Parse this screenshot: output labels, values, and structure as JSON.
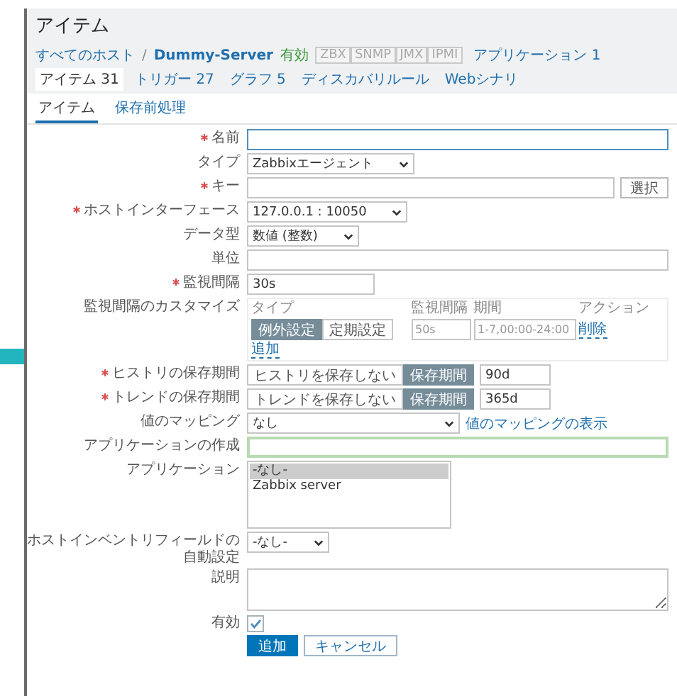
{
  "page_title": "アイテム",
  "host_nav": {
    "all_hosts": "すべてのホスト",
    "separator": "/",
    "host": "Dummy-Server",
    "status": "有効",
    "interfaces": [
      {
        "label": "ZBX",
        "available": false
      },
      {
        "label": "SNMP",
        "available": false
      },
      {
        "label": "JMX",
        "available": false
      },
      {
        "label": "IPMI",
        "available": false
      }
    ],
    "tabs": [
      {
        "label": "アプリケーション 1",
        "selected": false
      },
      {
        "label": "アイテム 31",
        "selected": true
      },
      {
        "label": "トリガー 27",
        "selected": false
      },
      {
        "label": "グラフ 5",
        "selected": false
      },
      {
        "label": "ディスカバリルール",
        "selected": false
      },
      {
        "label": "Webシナリ",
        "selected": false
      }
    ]
  },
  "sub_tabs": [
    {
      "label": "アイテム",
      "selected": true
    },
    {
      "label": "保存前処理",
      "selected": false
    }
  ],
  "form": {
    "rows": [
      {
        "kind": "text",
        "label": "名前",
        "required": true,
        "focused": true
      },
      {
        "kind": "select",
        "label": "タイプ",
        "required": false,
        "value": "Zabbixエージェント"
      },
      {
        "kind": "text_button",
        "label": "キー",
        "required": true,
        "button": "選択"
      },
      {
        "kind": "select",
        "label": "ホストインターフェース",
        "required": true,
        "value": "127.0.0.1 : 10050"
      },
      {
        "kind": "select",
        "label": "データ型",
        "required": false,
        "value": "数値 (整数)"
      },
      {
        "kind": "text",
        "label": "単位",
        "required": false
      },
      {
        "kind": "short_text",
        "label": "監視間隔",
        "required": true,
        "value": "30s"
      },
      {
        "kind": "intervals",
        "label": "監視間隔のカスタマイズ",
        "required": false,
        "columns": [
          "タイプ",
          "監視間隔",
          "期間",
          "アクション"
        ],
        "rows": [
          {
            "options": [
              {
                "label": "例外設定",
                "selected": true
              },
              {
                "label": "定期設定",
                "selected": false
              }
            ],
            "interval_placeholder": "50s",
            "period_placeholder": "1-7,00:00-24:00",
            "remove": "削除"
          }
        ],
        "add": "追加"
      },
      {
        "kind": "storage",
        "label": "ヒストリの保存期間",
        "required": true,
        "options": [
          {
            "label": "ヒストリを保存しない",
            "selected": false
          },
          {
            "label": "保存期間",
            "selected": true
          }
        ],
        "value": "90d"
      },
      {
        "kind": "storage",
        "label": "トレンドの保存期間",
        "required": true,
        "options": [
          {
            "label": "トレンドを保存しない",
            "selected": false
          },
          {
            "label": "保存期間",
            "selected": true
          }
        ],
        "value": "365d"
      },
      {
        "kind": "select_link",
        "label": "値のマッピング",
        "required": false,
        "value": "なし",
        "link": "値のマッピングの表示"
      },
      {
        "kind": "text",
        "label": "アプリケーションの作成",
        "required": false,
        "validated": true
      },
      {
        "kind": "listbox",
        "label": "アプリケーション",
        "required": false,
        "items": [
          {
            "label": "-なし-",
            "selected": true
          },
          {
            "label": "Zabbix server",
            "selected": false
          }
        ]
      },
      {
        "kind": "select",
        "label": "ホストインベントリフィールドの自動設定",
        "required": false,
        "value": "-なし-"
      },
      {
        "kind": "textarea",
        "label": "説明",
        "required": false
      },
      {
        "kind": "checkbox",
        "label": "有効",
        "required": false,
        "checked": true
      }
    ],
    "buttons": [
      {
        "label": "追加",
        "primary": true
      },
      {
        "label": "キャンセル",
        "primary": false
      }
    ]
  }
}
